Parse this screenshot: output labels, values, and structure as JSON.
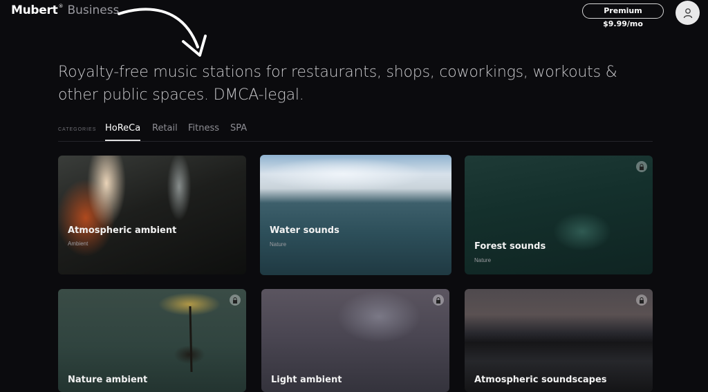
{
  "header": {
    "brand_name": "Mubert",
    "brand_mark": "®",
    "brand_suffix": "Business",
    "premium_label": "Premium $9.99/mo",
    "avatar_icon": "user-icon"
  },
  "hero": {
    "headline": "Royalty-free music stations for restaurants, shops, coworkings, workouts & other public spaces. DMCA-legal."
  },
  "categories": {
    "label": "CATEGORIES",
    "tabs": [
      {
        "label": "HoReCa",
        "active": true
      },
      {
        "label": "Retail",
        "active": false
      },
      {
        "label": "Fitness",
        "active": false
      },
      {
        "label": "SPA",
        "active": false
      }
    ]
  },
  "stations": [
    {
      "title": "Atmospheric ambient",
      "genre": "Ambient",
      "locked": false
    },
    {
      "title": "Water sounds",
      "genre": "Nature",
      "locked": false
    },
    {
      "title": "Forest sounds",
      "genre": "Nature",
      "locked": true
    },
    {
      "title": "Nature ambient",
      "genre": "",
      "locked": true
    },
    {
      "title": "Light ambient",
      "genre": "",
      "locked": true
    },
    {
      "title": "Atmospheric soundscapes",
      "genre": "",
      "locked": true
    }
  ]
}
